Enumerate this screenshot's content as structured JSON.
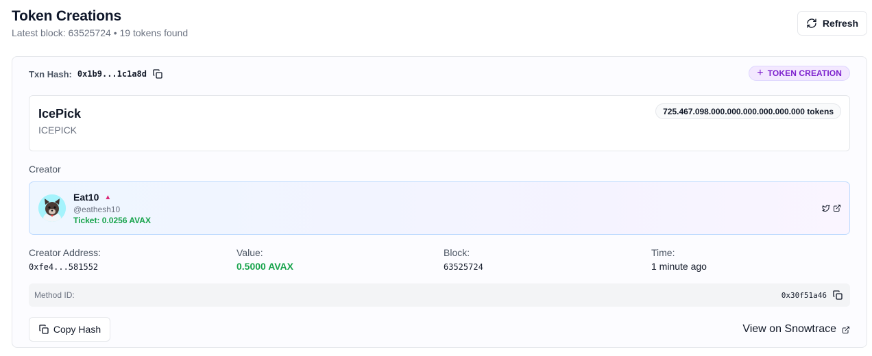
{
  "header": {
    "title": "Token Creations",
    "latest_block_label": "Latest block:",
    "latest_block": "63525724",
    "separator": "•",
    "tokens_found": "19 tokens found",
    "refresh_label": "Refresh"
  },
  "transaction": {
    "hash_label": "Txn Hash:",
    "hash": "0x1b9...1c1a8d",
    "type_badge": "TOKEN CREATION"
  },
  "token": {
    "name": "IcePick",
    "symbol": "ICEPICK",
    "supply": "725.467.098.000.000.000.000.000.000 tokens"
  },
  "creator": {
    "section_label": "Creator",
    "name": "Eat10",
    "trend_indicator": "▲",
    "handle": "@eathesh10",
    "ticket": "Ticket: 0.0256 AVAX"
  },
  "stats": {
    "creator_address_label": "Creator Address:",
    "creator_address": "0xfe4...581552",
    "value_label": "Value:",
    "value": "0.5000 AVAX",
    "block_label": "Block:",
    "block": "63525724",
    "time_label": "Time:",
    "time": "1 minute ago"
  },
  "method": {
    "label": "Method ID:",
    "id": "0x30f51a46"
  },
  "actions": {
    "copy_hash_label": "Copy Hash",
    "view_snowtrace_label": "View on Snowtrace"
  },
  "colors": {
    "accent_purple": "#7e22ce",
    "badge_bg": "#f3e8ff",
    "success_green": "#16a34a",
    "creator_border": "#bfdbfe"
  }
}
